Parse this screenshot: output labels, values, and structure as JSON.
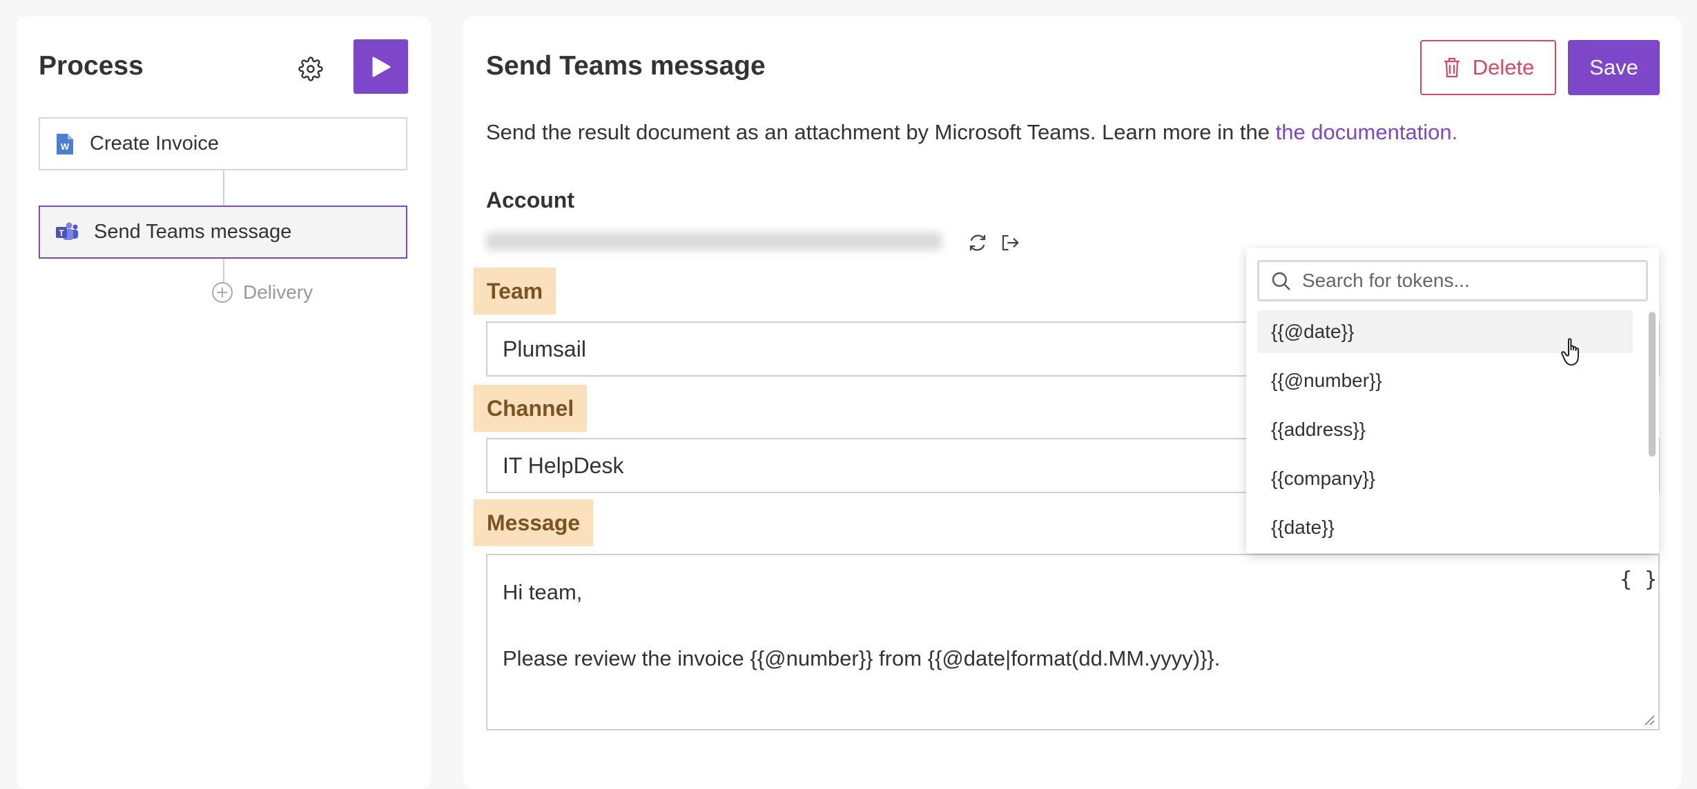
{
  "process": {
    "title": "Process",
    "steps": [
      {
        "label": "Create Invoice",
        "icon": "word-doc-icon"
      },
      {
        "label": "Send Teams message",
        "icon": "teams-icon"
      }
    ],
    "add_label": "Delivery"
  },
  "editor": {
    "title": "Send Teams message",
    "delete_label": "Delete",
    "save_label": "Save",
    "description": "Send the result document as an attachment by Microsoft Teams. Learn more in the ",
    "doc_link": "the documentation.",
    "account_label": "Account",
    "team_label": "Team",
    "team_value": "Plumsail",
    "channel_label": "Channel",
    "channel_value": "IT HelpDesk",
    "message_label": "Message",
    "message_line1": "Hi team,",
    "message_line2": "Please review the invoice {{@number}} from {{@date|format(dd.MM.yyyy)}}.",
    "token_icon_text": "{ }"
  },
  "token_picker": {
    "search_placeholder": "Search for tokens...",
    "tokens": [
      "{{@date}}",
      "{{@number}}",
      "{{address}}",
      "{{company}}",
      "{{date}}"
    ]
  },
  "colors": {
    "accent": "#7e46c9",
    "danger": "#d9485f",
    "label_bg": "#fae0bd",
    "link": "#7e46c9"
  }
}
